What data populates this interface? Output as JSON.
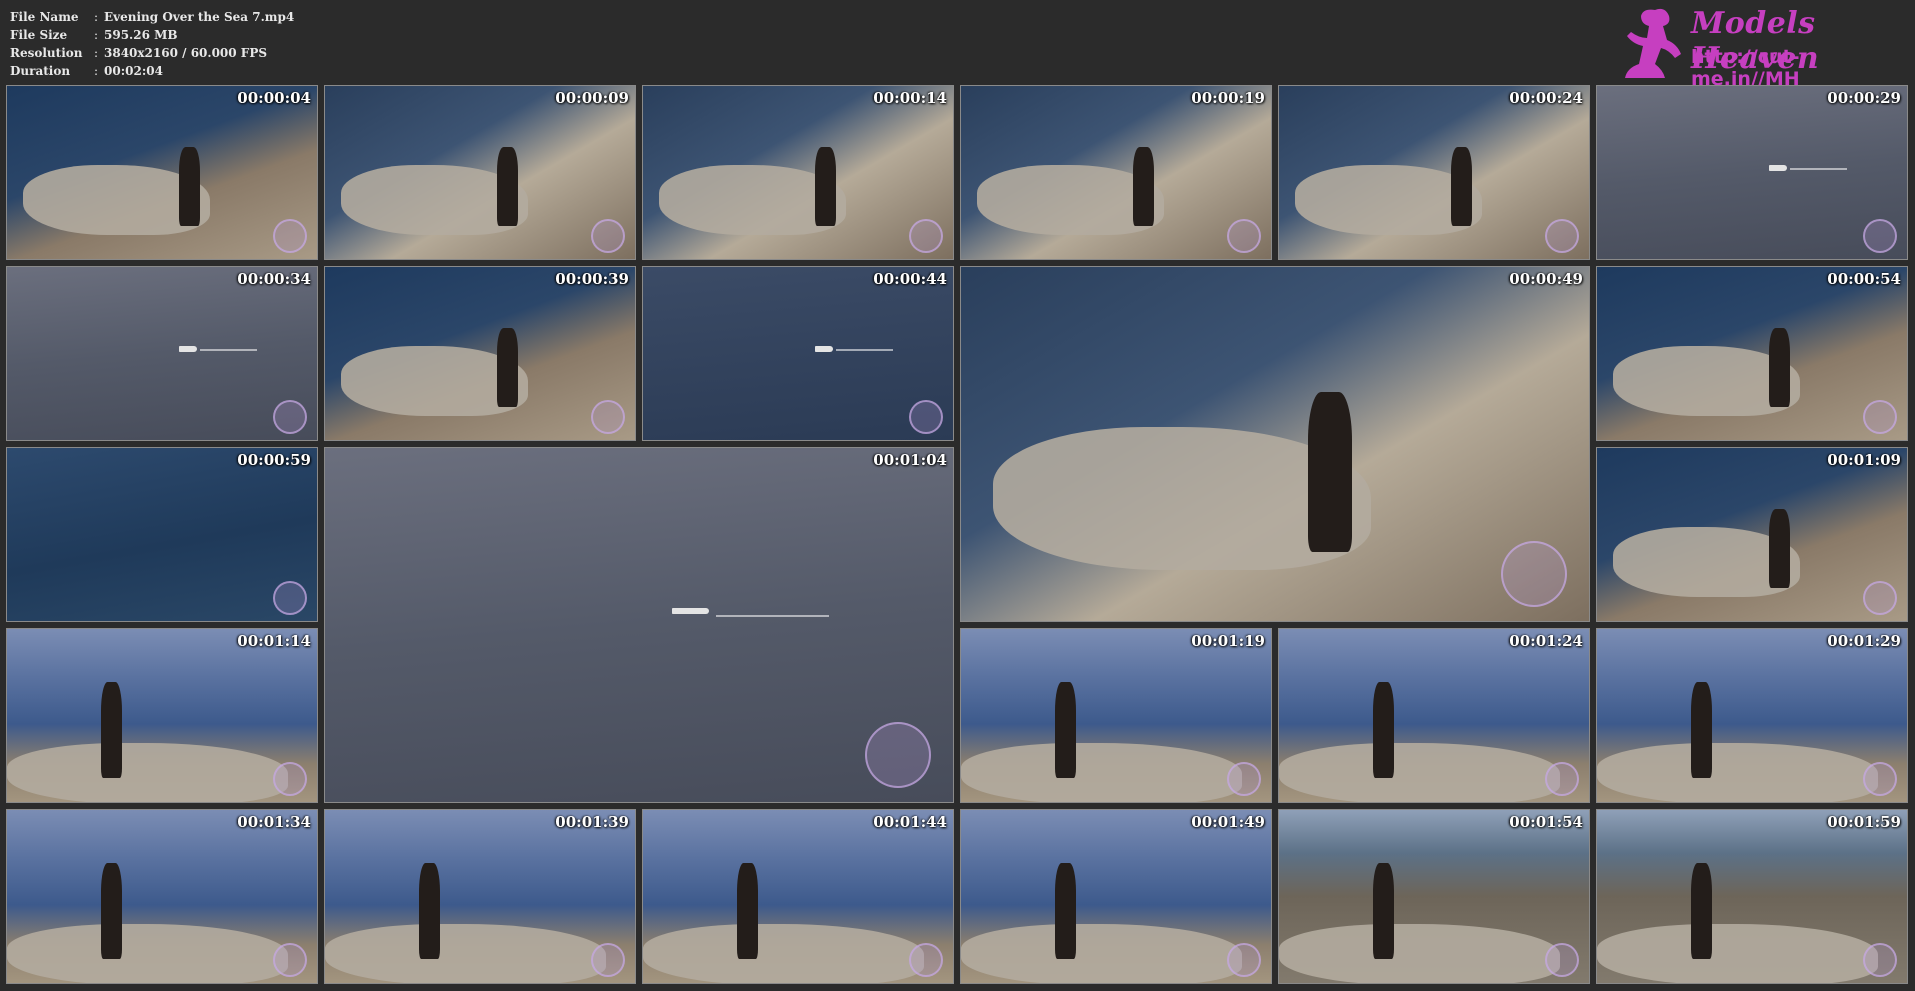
{
  "header": {
    "file_name_label": "File Name",
    "file_name": "Evening Over the Sea 7.mp4",
    "file_size_label": "File Size",
    "file_size": "595.26 MB",
    "resolution_label": "Resolution",
    "resolution": "3840x2160 / 60.000 FPS",
    "duration_label": "Duration",
    "duration": "00:02:04",
    "separator": ":"
  },
  "logo": {
    "brand": "Models Heaven",
    "url": "http://cut-me.in//MH",
    "color": "#c63fc0"
  },
  "thumbnails": [
    {
      "time": "00:00:04",
      "scene": "cliff"
    },
    {
      "time": "00:00:09",
      "scene": "cliff2"
    },
    {
      "time": "00:00:14",
      "scene": "cliff2"
    },
    {
      "time": "00:00:19",
      "scene": "cliff2"
    },
    {
      "time": "00:00:24",
      "scene": "cliff2"
    },
    {
      "time": "00:00:29",
      "scene": "sea2"
    },
    {
      "time": "00:00:34",
      "scene": "sea2"
    },
    {
      "time": "00:00:39",
      "scene": "cliff"
    },
    {
      "time": "00:00:44",
      "scene": "sea3"
    },
    {
      "time": "00:00:49",
      "scene": "cliff2"
    },
    {
      "time": "00:00:54",
      "scene": "cliff"
    },
    {
      "time": "00:00:59",
      "scene": "sea"
    },
    {
      "time": "00:01:04",
      "scene": "sea2"
    },
    {
      "time": "00:01:09",
      "scene": "cliff"
    },
    {
      "time": "00:01:14",
      "scene": "dusk"
    },
    {
      "time": "00:01:19",
      "scene": "dusk"
    },
    {
      "time": "00:01:24",
      "scene": "dusk"
    },
    {
      "time": "00:01:29",
      "scene": "dusk"
    },
    {
      "time": "00:01:34",
      "scene": "dusk"
    },
    {
      "time": "00:01:39",
      "scene": "dusk"
    },
    {
      "time": "00:01:44",
      "scene": "dusk"
    },
    {
      "time": "00:01:49",
      "scene": "dusk"
    },
    {
      "time": "00:01:54",
      "scene": "path"
    },
    {
      "time": "00:01:59",
      "scene": "path"
    }
  ]
}
